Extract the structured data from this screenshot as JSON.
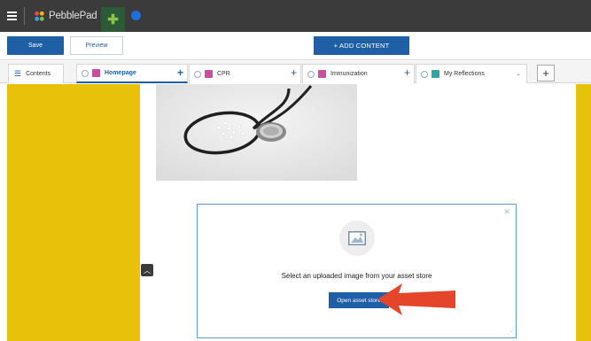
{
  "app": {
    "brand": "PebblePad"
  },
  "toolbar": {
    "save_label": "Save",
    "preview_label": "Preview",
    "add_content_label": "+ ADD CONTENT"
  },
  "tabs": {
    "contents_label": "Contents",
    "items": [
      {
        "label": "Homepage",
        "badge": "Pe",
        "badge_color": "#c94f9c"
      },
      {
        "label": "CPR",
        "badge": "Pe",
        "badge_color": "#c94f9c"
      },
      {
        "label": "Immunization",
        "badge": "Pe",
        "badge_color": "#c94f9c"
      },
      {
        "label": "My Reflections",
        "badge": "Pe",
        "badge_color": "#2fa7a0"
      }
    ]
  },
  "dialog": {
    "message": "Select an uploaded image from your asset store",
    "button_label": "Open asset store"
  },
  "colors": {
    "accent": "#1f5fa6",
    "yellow": "#e8c10b",
    "topbar": "#3b3b3b",
    "arrow": "#e5452b"
  }
}
